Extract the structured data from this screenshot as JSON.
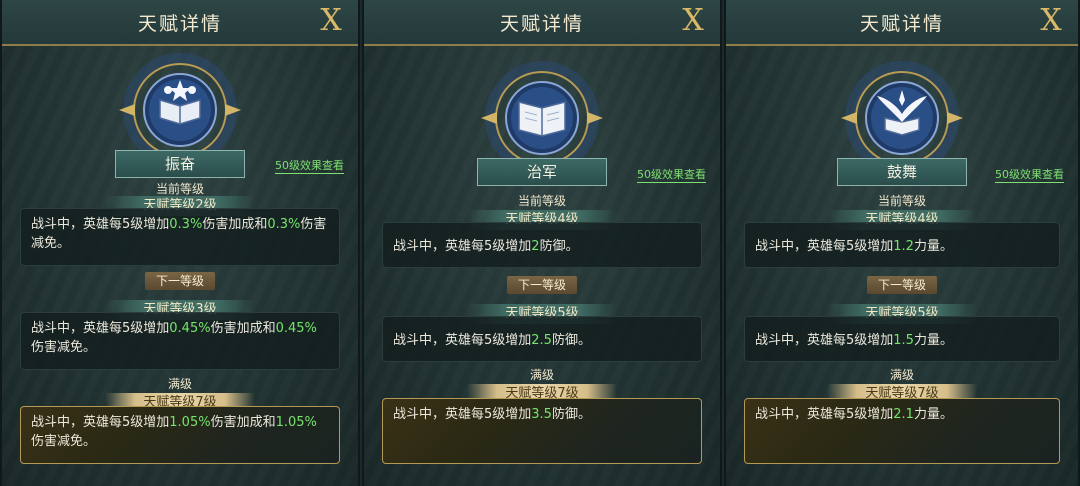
{
  "panels": [
    {
      "title": "天赋详情",
      "close_label": "X",
      "emblem_icon": "book-stars-icon",
      "talent_name": "振奋",
      "effect_link": "50级效果查看",
      "current_label": "当前等级",
      "current_level": "天赋等级2级",
      "current_desc": [
        "战斗中，英雄每5级增加",
        "0.3%",
        "伤害加成和",
        "0.3%",
        "伤害减免。"
      ],
      "next_label": "下一等级",
      "next_level": "天赋等级3级",
      "next_desc": [
        "战斗中，英雄每5级增加",
        "0.45%",
        "伤害加成和",
        "0.45%",
        "伤害减免。"
      ],
      "max_label": "满级",
      "max_level": "天赋等级7级",
      "max_desc": [
        "战斗中，英雄每5级增加",
        "1.05%",
        "伤害加成和",
        "1.05%",
        "伤害减免。"
      ]
    },
    {
      "title": "天赋详情",
      "close_label": "X",
      "emblem_icon": "open-book-icon",
      "talent_name": "治军",
      "effect_link": "50级效果查看",
      "current_label": "当前等级",
      "current_level": "天赋等级4级",
      "current_desc": [
        "战斗中，英雄每5级增加",
        "2",
        "防御。",
        "",
        ""
      ],
      "next_label": "下一等级",
      "next_level": "天赋等级5级",
      "next_desc": [
        "战斗中，英雄每5级增加",
        "2.5",
        "防御。",
        "",
        ""
      ],
      "max_label": "满级",
      "max_level": "天赋等级7级",
      "max_desc": [
        "战斗中，英雄每5级增加",
        "3.5",
        "防御。",
        "",
        ""
      ]
    },
    {
      "title": "天赋详情",
      "close_label": "X",
      "emblem_icon": "winged-book-icon",
      "talent_name": "鼓舞",
      "effect_link": "50级效果查看",
      "current_label": "当前等级",
      "current_level": "天赋等级4级",
      "current_desc": [
        "战斗中，英雄每5级增加",
        "1.2",
        "力量。",
        "",
        ""
      ],
      "next_label": "下一等级",
      "next_level": "天赋等级5级",
      "next_desc": [
        "战斗中，英雄每5级增加",
        "1.5",
        "力量。",
        "",
        ""
      ],
      "max_label": "满级",
      "max_level": "天赋等级7级",
      "max_desc": [
        "战斗中，英雄每5级增加",
        "2.1",
        "力量。",
        "",
        ""
      ]
    }
  ],
  "colors": {
    "highlight": "#76e46b",
    "gold": "#d9b968",
    "panel_bg": "#223433"
  }
}
